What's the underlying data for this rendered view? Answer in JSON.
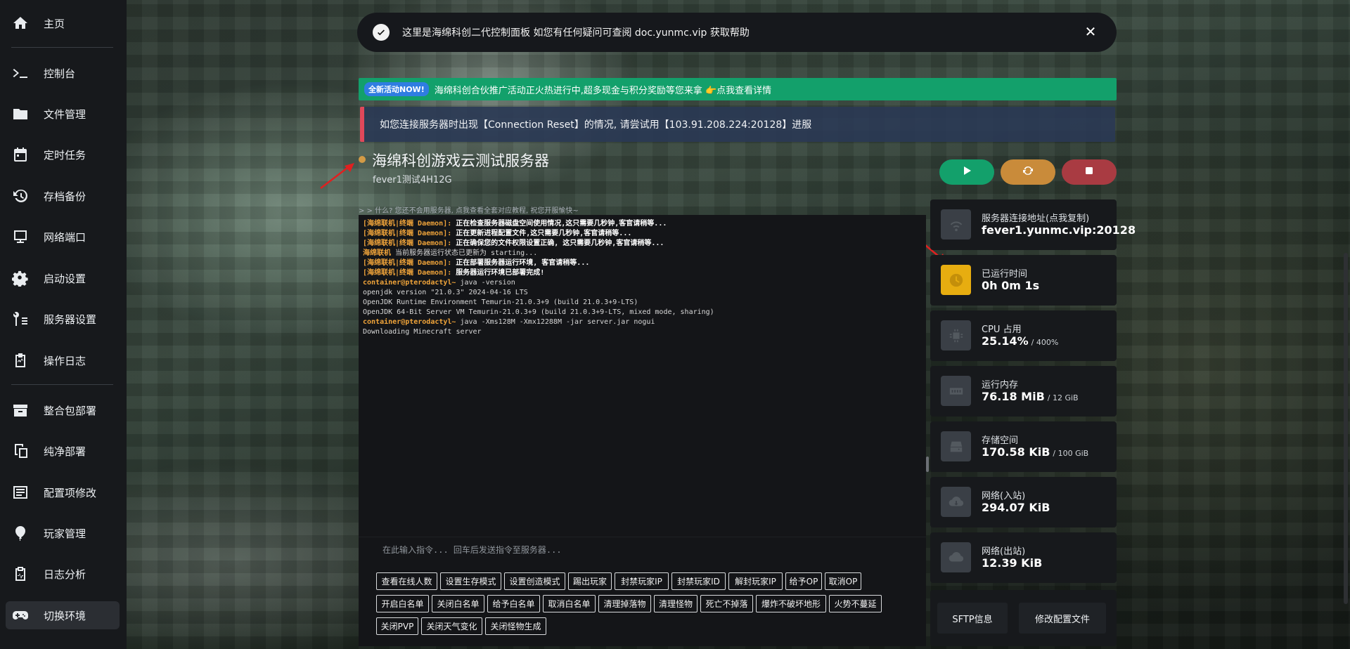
{
  "sidebar": {
    "items": [
      {
        "label": "主页",
        "icon": "home-icon"
      },
      {
        "label": "控制台",
        "icon": "terminal-icon"
      },
      {
        "label": "文件管理",
        "icon": "folder-icon"
      },
      {
        "label": "定时任务",
        "icon": "calendar-icon"
      },
      {
        "label": "存档备份",
        "icon": "backup-icon"
      },
      {
        "label": "网络端口",
        "icon": "network-icon"
      },
      {
        "label": "启动设置",
        "icon": "gear-icon"
      },
      {
        "label": "服务器设置",
        "icon": "wrench-icon"
      },
      {
        "label": "操作日志",
        "icon": "clipboard-icon"
      },
      {
        "label": "整合包部署",
        "icon": "package-icon"
      },
      {
        "label": "纯净部署",
        "icon": "copy-icon"
      },
      {
        "label": "配置项修改",
        "icon": "list-icon"
      },
      {
        "label": "玩家管理",
        "icon": "balloon-icon"
      },
      {
        "label": "日志分析",
        "icon": "chart-icon"
      },
      {
        "label": "切换环境",
        "icon": "gamepad-icon"
      }
    ]
  },
  "toast": {
    "message": "这里是海绵科创二代控制面板 如您有任何疑问可查阅 doc.yunmc.vip 获取帮助"
  },
  "promo": {
    "badge": "全新活动NOW!",
    "text": "海绵科创合伙推广活动正火热进行中,超多现金与积分奖励等您来拿 👉点我查看详情"
  },
  "notice": {
    "text": "如您连接服务器时出现【Connection Reset】的情况, 请尝试用【103.91.208.224:20128】进服"
  },
  "server": {
    "title": "海绵科创游戏云测试服务器",
    "subtitle": "fever1测试4H12G",
    "hint": "> > 什么? 您还不会用服务器, 点我查看全套对应教程, 祝您开服愉快~",
    "status_color": "#d39b46"
  },
  "controls": {
    "start_color": "#13a06b",
    "restart_color": "#c98b3a",
    "stop_color": "#a93b42"
  },
  "console": {
    "lines": [
      {
        "prefix": "[海绵联机|终端 Daemon]:",
        "text": " 正在检查服务器磁盘空间使用情况,这只需要几秒钟,客官请稍等..."
      },
      {
        "prefix": "[海绵联机|终端 Daemon]:",
        "text": " 正在更新进程配置文件,这只需要几秒钟,客官请稍等..."
      },
      {
        "prefix": "[海绵联机|终端 Daemon]:",
        "text": " 正在确保您的文件权限设置正确, 这只需要几秒钟,客官请稍等..."
      },
      {
        "prefix": "海绵联机",
        "text": " 当前服务器运行状态已更新为 starting..."
      },
      {
        "prefix": "[海绵联机|终端 Daemon]:",
        "text": " 正在部署服务器运行环境, 客官请稍等..."
      },
      {
        "prefix": "[海绵联机|终端 Daemon]:",
        "text": " 服务器运行环境已部署完成!"
      },
      {
        "prefix": "container@pterodactyl~",
        "text": " java -version"
      },
      {
        "prefix": "",
        "text": "openjdk version \"21.0.3\" 2024-04-16 LTS"
      },
      {
        "prefix": "",
        "text": "OpenJDK Runtime Environment Temurin-21.0.3+9 (build 21.0.3+9-LTS)"
      },
      {
        "prefix": "",
        "text": "OpenJDK 64-Bit Server VM Temurin-21.0.3+9 (build 21.0.3+9-LTS, mixed mode, sharing)"
      },
      {
        "prefix": "container@pterodactyl~",
        "text": " java -Xms128M -Xmx12288M -jar server.jar nogui"
      },
      {
        "prefix": "",
        "text": "Downloading Minecraft server"
      }
    ],
    "input_placeholder": "在此输入指令... 回车后发送指令至服务器..."
  },
  "quick_buttons": [
    [
      "查看在线人数",
      "设置生存模式",
      "设置创造模式",
      "踢出玩家",
      "封禁玩家IP",
      "封禁玩家ID",
      "解封玩家IP",
      "给予OP",
      "取消OP"
    ],
    [
      "开启白名单",
      "关闭白名单",
      "给予白名单",
      "取消白名单",
      "清理掉落物",
      "清理怪物",
      "死亡不掉落",
      "爆炸不破坏地形",
      "火势不蔓延"
    ],
    [
      "关闭PVP",
      "关闭天气变化",
      "关闭怪物生成"
    ]
  ],
  "stats": [
    {
      "key": "服务器连接地址(点我复制)",
      "value": "fever1.yunmc.vip:20128",
      "unit": "",
      "icon": "wifi-icon",
      "accent": "#3a3f46"
    },
    {
      "key": "已运行时间",
      "value": "0h 0m 1s",
      "unit": "",
      "icon": "clock-icon",
      "accent": "#e7ad10"
    },
    {
      "key": "CPU 占用",
      "value": "25.14%",
      "unit": "/ 400%",
      "icon": "cpu-icon",
      "accent": "#3a3f46"
    },
    {
      "key": "运行内存",
      "value": "76.18 MiB",
      "unit": "/ 12 GiB",
      "icon": "memory-icon",
      "accent": "#3a3f46"
    },
    {
      "key": "存储空间",
      "value": "170.58 KiB",
      "unit": "/ 100 GiB",
      "icon": "hdd-icon",
      "accent": "#3a3f46"
    },
    {
      "key": "网络(入站)",
      "value": "294.07 KiB",
      "unit": "",
      "icon": "cloud-download-icon",
      "accent": "#3a3f46"
    },
    {
      "key": "网络(出站)",
      "value": "12.39 KiB",
      "unit": "",
      "icon": "cloud-upload-icon",
      "accent": "#3a3f46"
    }
  ],
  "links": {
    "sftp": "SFTP信息",
    "edit_config": "修改配置文件"
  }
}
